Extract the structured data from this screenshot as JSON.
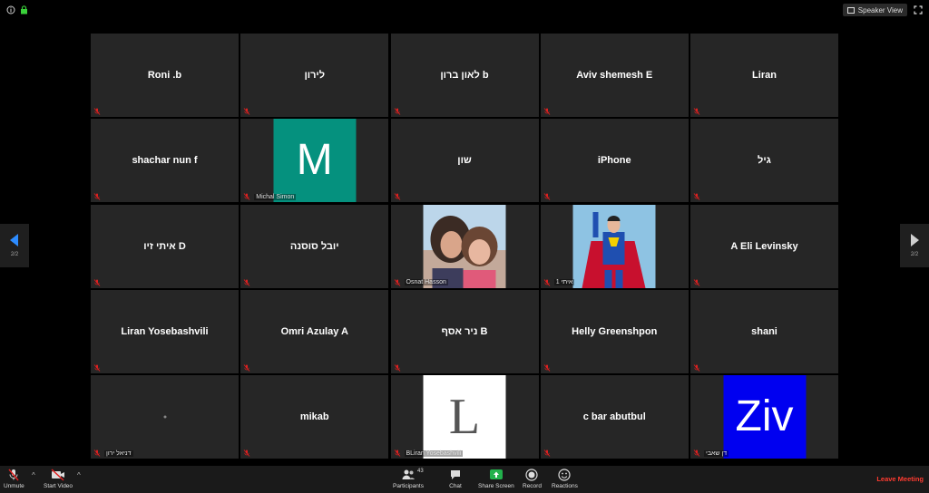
{
  "topbar": {
    "speaker_view_label": "Speaker View"
  },
  "tiles": [
    {
      "name": "Roni .b"
    },
    {
      "name": "לירון"
    },
    {
      "name": "לאון ברון b"
    },
    {
      "name": "Aviv shemesh E"
    },
    {
      "name": "Liran"
    },
    {
      "name": "shachar nun f"
    },
    {
      "name": "",
      "avatar": "M",
      "avatar_color": "#05917E",
      "footer": "Michal Simon"
    },
    {
      "name": "שון"
    },
    {
      "name": "iPhone"
    },
    {
      "name": "גיל"
    },
    {
      "name": "איתי זיו D"
    },
    {
      "name": "יובל סוסנה"
    },
    {
      "name": "",
      "photo": "photo-women",
      "footer": "Osnat Hasson"
    },
    {
      "name": "",
      "photo": "photo-superman",
      "footer": "איתי 1"
    },
    {
      "name": "A Eli Levinsky"
    },
    {
      "name": "Liran Yosebashvili"
    },
    {
      "name": "Omri Azulay A"
    },
    {
      "name": "ניר אסף B"
    },
    {
      "name": "Helly Greenshpon"
    },
    {
      "name": "shani"
    },
    {
      "name": "",
      "dot": true,
      "footer": "דניאל ירון"
    },
    {
      "name": "mikab"
    },
    {
      "name": "",
      "avatar": "L",
      "avatar_color": "#FFFFFF",
      "avatar_text_color": "#555555",
      "footer": "BLiran Yosebashvili"
    },
    {
      "name": "c bar abutbul"
    },
    {
      "name": "",
      "avatar": "Ziv",
      "avatar_color": "#0000F0",
      "footer": "דן שאבי"
    }
  ],
  "pager": {
    "left": "2/2",
    "right": "2/2"
  },
  "toolbar": {
    "unmute": "Unmute",
    "start_video": "Start Video",
    "participants": "Participants",
    "participants_count": "43",
    "chat": "Chat",
    "share_screen": "Share Screen",
    "record": "Record",
    "reactions": "Reactions",
    "leave": "Leave Meeting"
  },
  "colors": {
    "tile_bg": "#262626",
    "mic_muted": "#e02020",
    "share_green": "#22b14c",
    "leave_red": "#ff3b30"
  }
}
